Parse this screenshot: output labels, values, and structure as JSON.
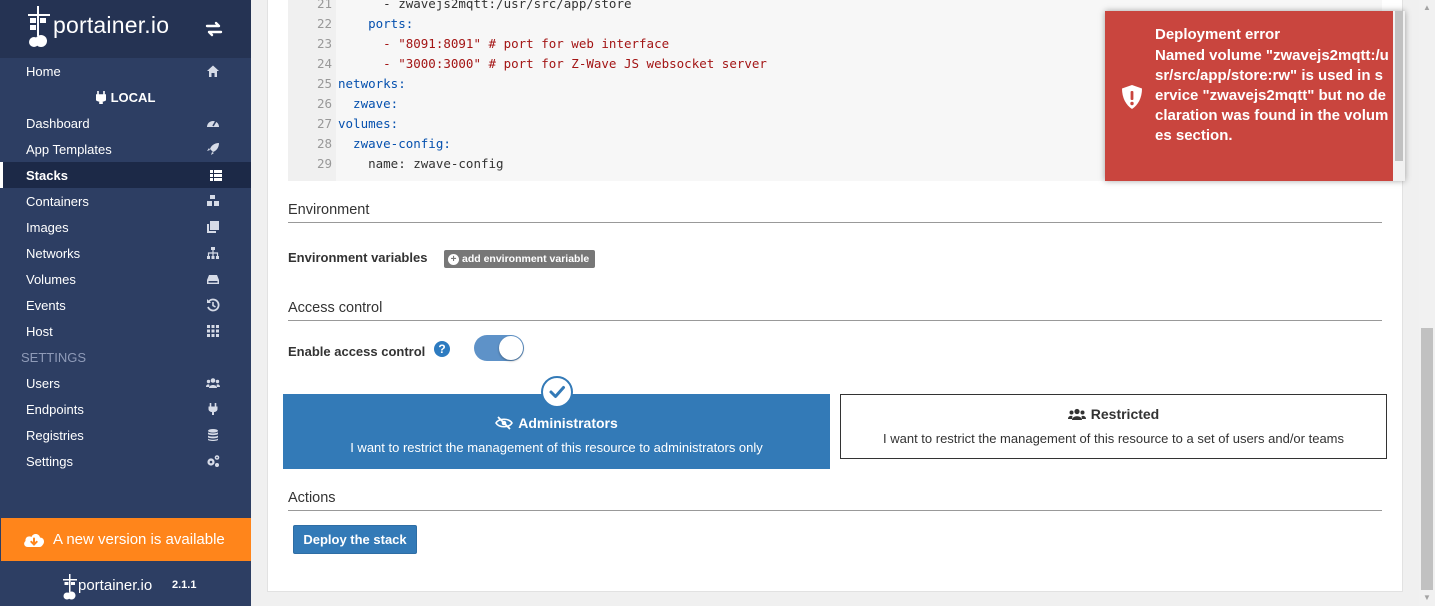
{
  "brand": {
    "name": "portainer.io"
  },
  "nav": {
    "home": "Home",
    "endpoint": "LOCAL",
    "items": [
      "Dashboard",
      "App Templates",
      "Stacks",
      "Containers",
      "Images",
      "Networks",
      "Volumes",
      "Events",
      "Host"
    ],
    "settings_heading": "SETTINGS",
    "settings_items": [
      "Users",
      "Endpoints",
      "Registries",
      "Settings"
    ],
    "active": "Stacks"
  },
  "update_banner": "A new version is available",
  "footer": {
    "name": "portainer.io",
    "version": "2.1.1"
  },
  "editor": {
    "lines": [
      {
        "n": "21",
        "text": "      - zwavejs2mqtt:/usr/src/app/store"
      },
      {
        "n": "22",
        "text": "    ports:"
      },
      {
        "n": "23",
        "text": "      - \"8091:8091\" # port for web interface"
      },
      {
        "n": "24",
        "text": "      - \"3000:3000\" # port for Z-Wave JS websocket server"
      },
      {
        "n": "25",
        "text": "networks:"
      },
      {
        "n": "26",
        "text": "  zwave:"
      },
      {
        "n": "27",
        "text": "volumes:"
      },
      {
        "n": "28",
        "text": "  zwave-config:"
      },
      {
        "n": "29",
        "text": "    name: zwave-config"
      }
    ]
  },
  "environment": {
    "section": "Environment",
    "label": "Environment variables",
    "add_button": "add environment variable"
  },
  "access": {
    "section": "Access control",
    "enable_label": "Enable access control",
    "enabled": true,
    "admin_title": "Administrators",
    "admin_desc": "I want to restrict the management of this resource to administrators only",
    "restricted_title": "Restricted",
    "restricted_desc": "I want to restrict the management of this resource to a set of users and/or teams",
    "selected": "Administrators"
  },
  "actions": {
    "section": "Actions",
    "deploy_button": "Deploy the stack"
  },
  "toast": {
    "title": "Deployment error",
    "message": "Named volume \"zwavejs2mqtt:/usr/src/app/store:rw\" is used in service \"zwavejs2mqtt\" but no declaration was found in the volumes section."
  },
  "colors": {
    "sidebar": "#2d3e63",
    "primary": "#337ab7",
    "update": "#ff851b",
    "error": "#c9453e"
  }
}
